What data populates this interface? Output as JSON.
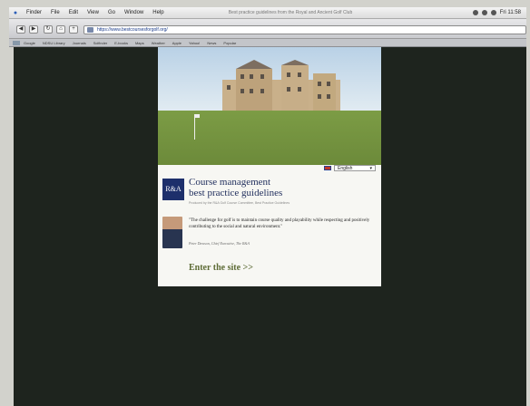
{
  "menubar": {
    "items": [
      "Finder",
      "File",
      "Edit",
      "View",
      "Go",
      "Window",
      "Help"
    ],
    "window_title": "Best practice guidelines from the Royal and Ancient Golf Club",
    "clock": "Fri 11:58"
  },
  "toolbar": {
    "back": "◀",
    "forward": "▶",
    "url": "https://www.bestcoursesforgolf.org/"
  },
  "bookmarks": [
    "Google",
    "NDSU Library",
    "Journals",
    "Scifinder",
    "E-books",
    "Maps",
    "Weather",
    "Apple",
    "Yahoo!",
    "News",
    "Popular"
  ],
  "page": {
    "language": "English",
    "logo_text": "R&A",
    "title_line1": "Course management",
    "title_line2": "best practice guidelines",
    "subtitle": "Produced by the R&A Golf Course Committee, Best Practice Guidelines",
    "quote": "\"The challenge for golf is to maintain course quality and playability while respecting and positively contributing to the social and natural environment.\"",
    "attribution": "Peter Dawson, Chief Executive, The R&A",
    "enter_link": "Enter the site >>"
  }
}
